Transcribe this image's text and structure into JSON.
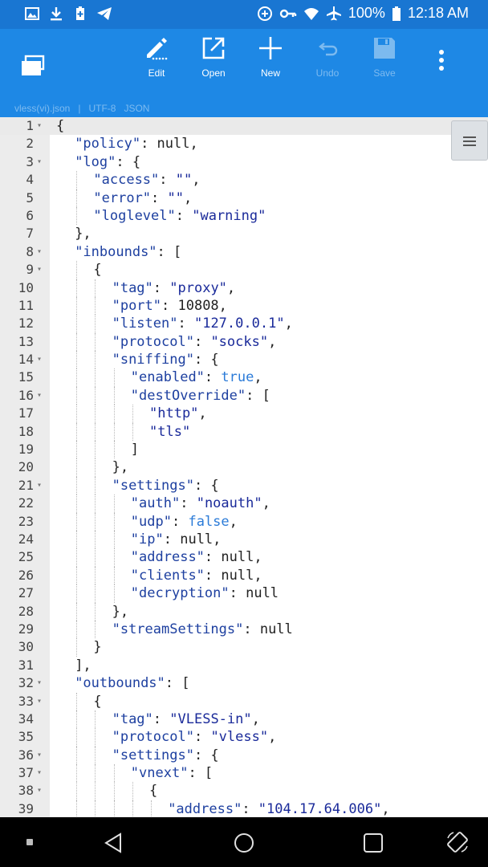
{
  "status_bar": {
    "battery": "100%",
    "time": "12:18 AM"
  },
  "toolbar": {
    "buttons": [
      {
        "id": "edit",
        "label": "Edit",
        "enabled": true
      },
      {
        "id": "open",
        "label": "Open",
        "enabled": true
      },
      {
        "id": "new",
        "label": "New",
        "enabled": true
      },
      {
        "id": "undo",
        "label": "Undo",
        "enabled": false
      },
      {
        "id": "save",
        "label": "Save",
        "enabled": false
      }
    ],
    "file_info": "vless(vi).json   |   UTF-8   JSON"
  },
  "editor": {
    "current_line": 1,
    "lines": [
      {
        "n": "1",
        "fold": true,
        "d": 0,
        "t": [
          [
            "p",
            "{"
          ]
        ]
      },
      {
        "n": "2",
        "fold": false,
        "d": 1,
        "t": [
          [
            "k",
            "\"policy\""
          ],
          [
            "p",
            ": null,"
          ]
        ]
      },
      {
        "n": "3",
        "fold": true,
        "d": 1,
        "t": [
          [
            "k",
            "\"log\""
          ],
          [
            "p",
            ": {"
          ]
        ]
      },
      {
        "n": "4",
        "fold": false,
        "d": 2,
        "t": [
          [
            "k",
            "\"access\""
          ],
          [
            "p",
            ": "
          ],
          [
            "s",
            "\"\""
          ],
          [
            "p",
            ","
          ]
        ]
      },
      {
        "n": "5",
        "fold": false,
        "d": 2,
        "t": [
          [
            "k",
            "\"error\""
          ],
          [
            "p",
            ": "
          ],
          [
            "s",
            "\"\""
          ],
          [
            "p",
            ","
          ]
        ]
      },
      {
        "n": "6",
        "fold": false,
        "d": 2,
        "t": [
          [
            "k",
            "\"loglevel\""
          ],
          [
            "p",
            ": "
          ],
          [
            "s",
            "\"warning\""
          ]
        ]
      },
      {
        "n": "7",
        "fold": false,
        "d": 1,
        "t": [
          [
            "p",
            "},"
          ]
        ]
      },
      {
        "n": "8",
        "fold": true,
        "d": 1,
        "t": [
          [
            "k",
            "\"inbounds\""
          ],
          [
            "p",
            ": ["
          ]
        ]
      },
      {
        "n": "9",
        "fold": true,
        "d": 2,
        "t": [
          [
            "p",
            "{"
          ]
        ]
      },
      {
        "n": "10",
        "fold": false,
        "d": 3,
        "t": [
          [
            "k",
            "\"tag\""
          ],
          [
            "p",
            ": "
          ],
          [
            "s",
            "\"proxy\""
          ],
          [
            "p",
            ","
          ]
        ]
      },
      {
        "n": "11",
        "fold": false,
        "d": 3,
        "t": [
          [
            "k",
            "\"port\""
          ],
          [
            "p",
            ": 10808,"
          ]
        ]
      },
      {
        "n": "12",
        "fold": false,
        "d": 3,
        "t": [
          [
            "k",
            "\"listen\""
          ],
          [
            "p",
            ": "
          ],
          [
            "s",
            "\"127.0.0.1\""
          ],
          [
            "p",
            ","
          ]
        ]
      },
      {
        "n": "13",
        "fold": false,
        "d": 3,
        "t": [
          [
            "k",
            "\"protocol\""
          ],
          [
            "p",
            ": "
          ],
          [
            "s",
            "\"socks\""
          ],
          [
            "p",
            ","
          ]
        ]
      },
      {
        "n": "14",
        "fold": true,
        "d": 3,
        "t": [
          [
            "k",
            "\"sniffing\""
          ],
          [
            "p",
            ": {"
          ]
        ]
      },
      {
        "n": "15",
        "fold": false,
        "d": 4,
        "t": [
          [
            "k",
            "\"enabled\""
          ],
          [
            "p",
            ": "
          ],
          [
            "b",
            "true"
          ],
          [
            "p",
            ","
          ]
        ]
      },
      {
        "n": "16",
        "fold": true,
        "d": 4,
        "t": [
          [
            "k",
            "\"destOverride\""
          ],
          [
            "p",
            ": ["
          ]
        ]
      },
      {
        "n": "17",
        "fold": false,
        "d": 5,
        "t": [
          [
            "s",
            "\"http\""
          ],
          [
            "p",
            ","
          ]
        ]
      },
      {
        "n": "18",
        "fold": false,
        "d": 5,
        "t": [
          [
            "s",
            "\"tls\""
          ]
        ]
      },
      {
        "n": "19",
        "fold": false,
        "d": 4,
        "t": [
          [
            "p",
            "]"
          ]
        ]
      },
      {
        "n": "20",
        "fold": false,
        "d": 3,
        "t": [
          [
            "p",
            "},"
          ]
        ]
      },
      {
        "n": "21",
        "fold": true,
        "d": 3,
        "t": [
          [
            "k",
            "\"settings\""
          ],
          [
            "p",
            ": {"
          ]
        ]
      },
      {
        "n": "22",
        "fold": false,
        "d": 4,
        "t": [
          [
            "k",
            "\"auth\""
          ],
          [
            "p",
            ": "
          ],
          [
            "s",
            "\"noauth\""
          ],
          [
            "p",
            ","
          ]
        ]
      },
      {
        "n": "23",
        "fold": false,
        "d": 4,
        "t": [
          [
            "k",
            "\"udp\""
          ],
          [
            "p",
            ": "
          ],
          [
            "b",
            "false"
          ],
          [
            "p",
            ","
          ]
        ]
      },
      {
        "n": "24",
        "fold": false,
        "d": 4,
        "t": [
          [
            "k",
            "\"ip\""
          ],
          [
            "p",
            ": null,"
          ]
        ]
      },
      {
        "n": "25",
        "fold": false,
        "d": 4,
        "t": [
          [
            "k",
            "\"address\""
          ],
          [
            "p",
            ": null,"
          ]
        ]
      },
      {
        "n": "26",
        "fold": false,
        "d": 4,
        "t": [
          [
            "k",
            "\"clients\""
          ],
          [
            "p",
            ": null,"
          ]
        ]
      },
      {
        "n": "27",
        "fold": false,
        "d": 4,
        "t": [
          [
            "k",
            "\"decryption\""
          ],
          [
            "p",
            ": null"
          ]
        ]
      },
      {
        "n": "28",
        "fold": false,
        "d": 3,
        "t": [
          [
            "p",
            "},"
          ]
        ]
      },
      {
        "n": "29",
        "fold": false,
        "d": 3,
        "t": [
          [
            "k",
            "\"streamSettings\""
          ],
          [
            "p",
            ": null"
          ]
        ]
      },
      {
        "n": "30",
        "fold": false,
        "d": 2,
        "t": [
          [
            "p",
            "}"
          ]
        ]
      },
      {
        "n": "31",
        "fold": false,
        "d": 1,
        "t": [
          [
            "p",
            "],"
          ]
        ]
      },
      {
        "n": "32",
        "fold": true,
        "d": 1,
        "t": [
          [
            "k",
            "\"outbounds\""
          ],
          [
            "p",
            ": ["
          ]
        ]
      },
      {
        "n": "33",
        "fold": true,
        "d": 2,
        "t": [
          [
            "p",
            "{"
          ]
        ]
      },
      {
        "n": "34",
        "fold": false,
        "d": 3,
        "t": [
          [
            "k",
            "\"tag\""
          ],
          [
            "p",
            ": "
          ],
          [
            "s",
            "\"VLESS-in\""
          ],
          [
            "p",
            ","
          ]
        ]
      },
      {
        "n": "35",
        "fold": false,
        "d": 3,
        "t": [
          [
            "k",
            "\"protocol\""
          ],
          [
            "p",
            ": "
          ],
          [
            "s",
            "\"vless\""
          ],
          [
            "p",
            ","
          ]
        ]
      },
      {
        "n": "36",
        "fold": true,
        "d": 3,
        "t": [
          [
            "k",
            "\"settings\""
          ],
          [
            "p",
            ": {"
          ]
        ]
      },
      {
        "n": "37",
        "fold": true,
        "d": 4,
        "t": [
          [
            "k",
            "\"vnext\""
          ],
          [
            "p",
            ": ["
          ]
        ]
      },
      {
        "n": "38",
        "fold": true,
        "d": 5,
        "t": [
          [
            "p",
            "{"
          ]
        ]
      },
      {
        "n": "39",
        "fold": false,
        "d": 6,
        "t": [
          [
            "k",
            "\"address\""
          ],
          [
            "p",
            ": "
          ],
          [
            "s",
            "\"104.17.64.006\""
          ],
          [
            "p",
            ","
          ]
        ]
      }
    ]
  },
  "icons": {
    "status_left": [
      "gallery-icon",
      "download-icon",
      "battery-saver-icon",
      "telegram-icon"
    ],
    "status_right": [
      "data-saver-icon",
      "vpn-key-icon",
      "wifi-icon",
      "airplane-icon",
      "battery-icon"
    ]
  },
  "colors": {
    "status_bar": "#1976d2",
    "toolbar": "#1e88e5",
    "key": "#1e40a0",
    "string": "#1a2a9a",
    "boolean": "#2b7bd8",
    "gutter": "#ececec"
  }
}
